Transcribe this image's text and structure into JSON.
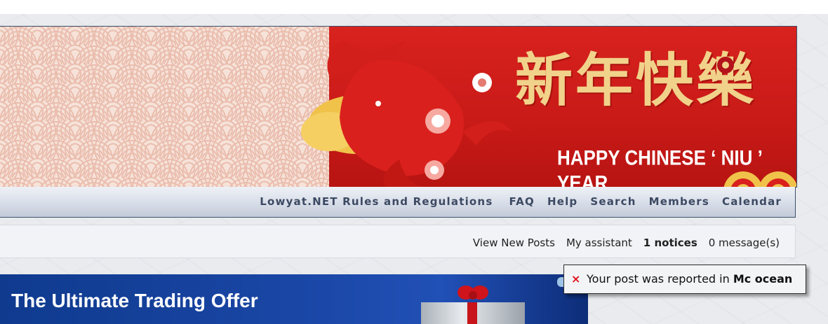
{
  "banner": {
    "chinese_text": "新年快樂",
    "english_text": "HAPPY CHINESE ‘ NIU ’ YEAR"
  },
  "nav": {
    "items": [
      {
        "label": "Lowyat.NET Rules and Regulations"
      },
      {
        "label": "FAQ"
      },
      {
        "label": "Help"
      },
      {
        "label": "Search"
      },
      {
        "label": "Members"
      },
      {
        "label": "Calendar"
      }
    ]
  },
  "subbar": {
    "view_new_posts": "View New Posts",
    "my_assistant": "My assistant",
    "notices": "1 notices",
    "messages": "0 message(s)"
  },
  "ad": {
    "title": "The Ultimate Trading Offer"
  },
  "notification": {
    "close_icon": "×",
    "text": "Your post was reported in ",
    "forum": "Mc ocean"
  },
  "colors": {
    "nav_text": "#3d4a63",
    "banner_red": "#c81a17",
    "ad_blue": "#1b48a8",
    "close_red": "#e0121b"
  }
}
